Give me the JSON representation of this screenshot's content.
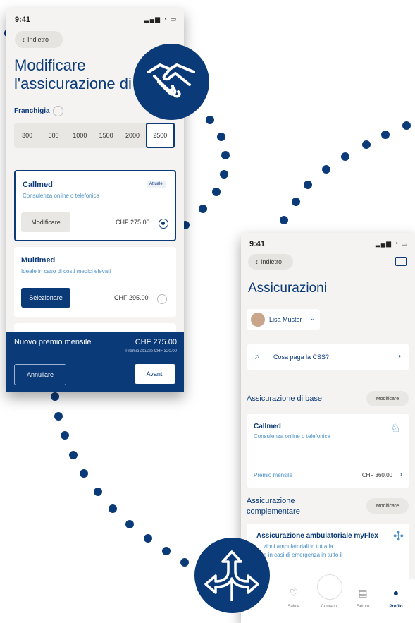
{
  "colors": {
    "brand": "#0b3a78",
    "accent": "#4a90c8",
    "dots": "#0b3a78"
  },
  "phone1": {
    "time": "9:41",
    "back_label": "Indietro",
    "title_line1": "Modificare",
    "title_line2": "l'assicurazione di",
    "franchise_label": "Franchigia",
    "franchise_options": [
      "300",
      "500",
      "1000",
      "1500",
      "2000",
      "2500"
    ],
    "cards": [
      {
        "title": "Callmed",
        "subtitle": "Consulenza online o telefonica",
        "button": "Modificare",
        "price": "CHF 275.00",
        "badge": "Attuale"
      },
      {
        "title": "Multimed",
        "subtitle": "Ideale in caso di costi medici elevati",
        "button": "Selezionare",
        "price": "CHF 295.00"
      }
    ],
    "bottom": {
      "new_premium_label": "Nuovo premio mensile",
      "new_premium_value": "CHF 275.00",
      "current_premium": "Premio attuale CHF 320.00",
      "cancel": "Annullare",
      "next": "Avanti"
    }
  },
  "phone2": {
    "time": "9:41",
    "back_label": "Indietro",
    "title": "Assicurazioni",
    "user": "Lisa Muster",
    "faq": "Cosa paga la CSS?",
    "base_section": "Assicurazione di base",
    "base_action": "Modificare",
    "base_card": {
      "title": "Callmed",
      "subtitle": "Consulenza online o telefonica",
      "premium_label": "Premio mensile",
      "premium_value": "CHF 360.00"
    },
    "supp_section_line1": "Assicurazione",
    "supp_section_line2": "complementare",
    "supp_action": "Modificare",
    "supp_card": {
      "title": "Assicurazione ambulatoriale myFlex",
      "line1": "zioni ambulatoriali in tutta la",
      "line2": "e in casi di emergenza in tutto il"
    },
    "nav": [
      "Salute",
      "Contatto",
      "Fatture",
      "Profilo"
    ]
  },
  "icons": {
    "handshake": "handshake-icon",
    "directions": "directions-arrows-icon"
  }
}
